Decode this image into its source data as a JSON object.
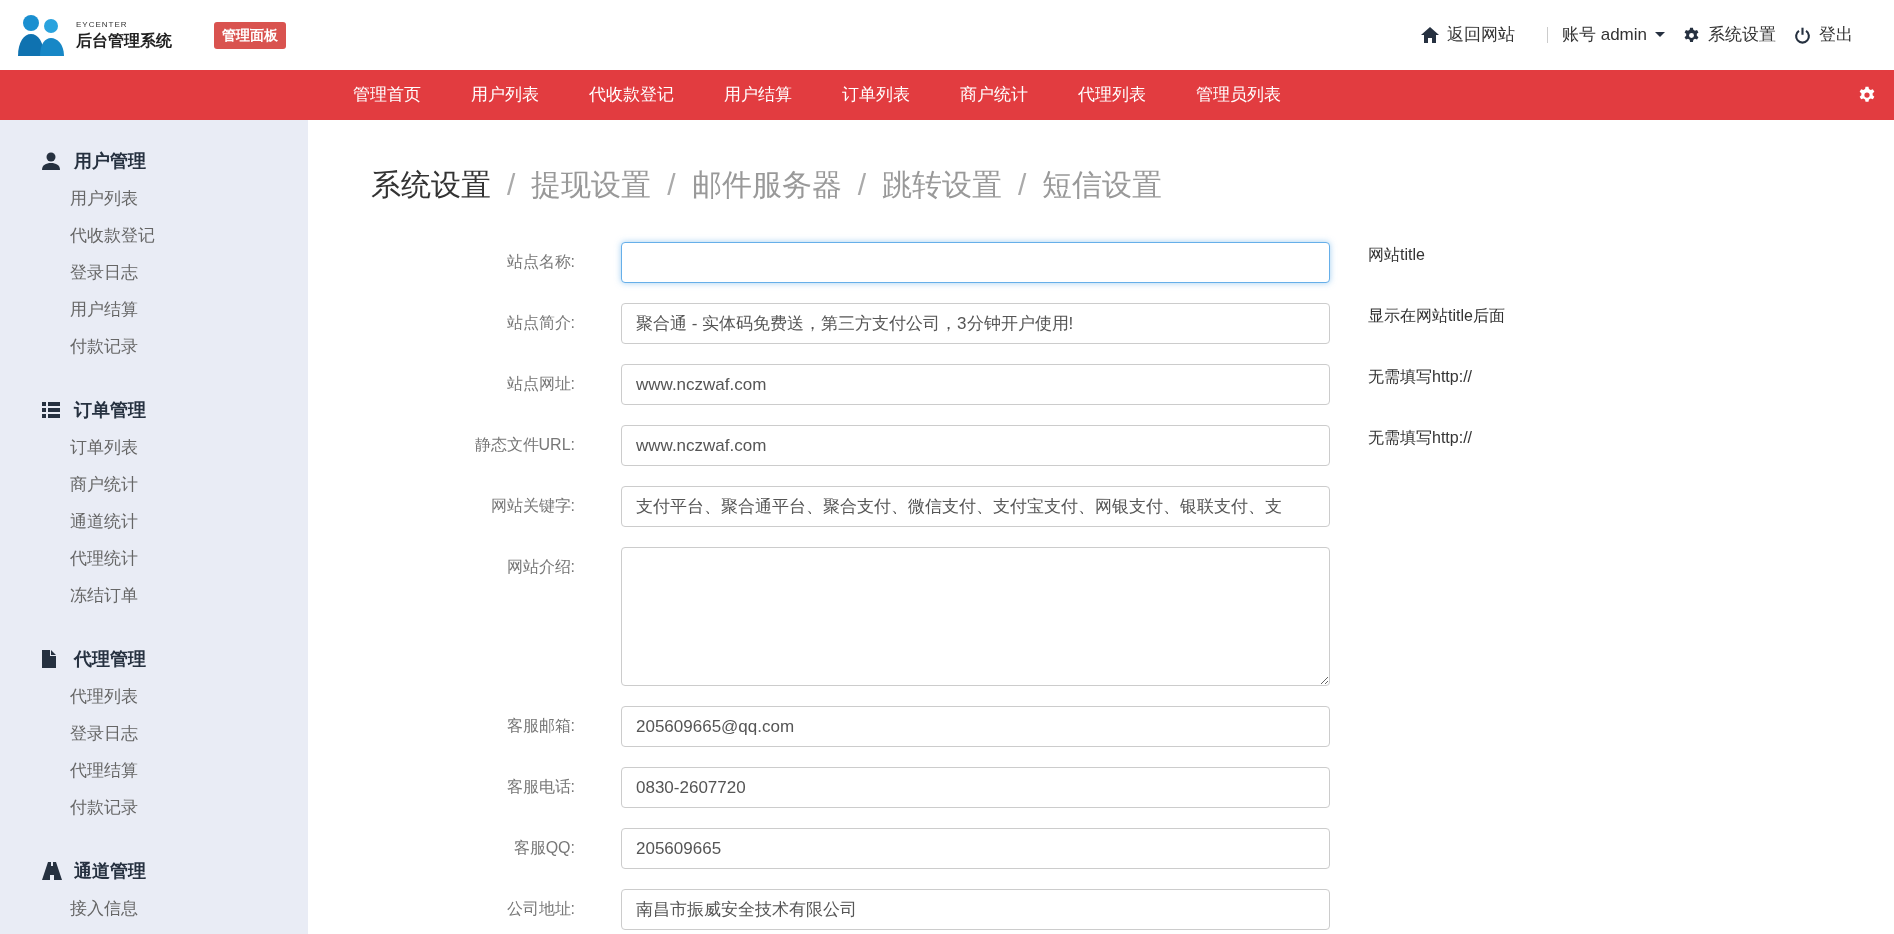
{
  "header": {
    "logo_caption": "EYCENTER",
    "logo_title": "后台管理系统",
    "badge": "管理面板",
    "links": [
      {
        "kind": "home",
        "label": "返回网站"
      },
      {
        "kind": "account",
        "label": "账号 admin"
      },
      {
        "kind": "settings",
        "label": "系统设置"
      },
      {
        "kind": "logout",
        "label": "登出"
      }
    ]
  },
  "nav": {
    "items": [
      "管理首页",
      "用户列表",
      "代收款登记",
      "用户结算",
      "订单列表",
      "商户统计",
      "代理列表",
      "管理员列表"
    ]
  },
  "sidebar": {
    "groups": [
      {
        "kind": "user",
        "title": "用户管理",
        "items": [
          "用户列表",
          "代收款登记",
          "登录日志",
          "用户结算",
          "付款记录"
        ]
      },
      {
        "kind": "list",
        "title": "订单管理",
        "items": [
          "订单列表",
          "商户统计",
          "通道统计",
          "代理统计",
          "冻结订单"
        ]
      },
      {
        "kind": "file",
        "title": "代理管理",
        "items": [
          "代理列表",
          "登录日志",
          "代理结算",
          "付款记录"
        ]
      },
      {
        "kind": "road",
        "title": "通道管理",
        "items": [
          "接入信息"
        ]
      }
    ]
  },
  "breadcrumb": [
    {
      "kind": "link",
      "label": "系统设置",
      "selected": true
    },
    {
      "kind": "separator",
      "label": "/"
    },
    {
      "kind": "link",
      "label": "提现设置",
      "selected": false
    },
    {
      "kind": "separator",
      "label": "/"
    },
    {
      "kind": "link",
      "label": "邮件服务器",
      "selected": false
    },
    {
      "kind": "separator",
      "label": "/"
    },
    {
      "kind": "link",
      "label": "跳转设置",
      "selected": false
    },
    {
      "kind": "separator",
      "label": "/"
    },
    {
      "kind": "link",
      "label": "短信设置",
      "selected": false
    }
  ],
  "form": {
    "fields": [
      {
        "kind": "input",
        "label": "站点名称:",
        "focused": true,
        "hint": "网站title"
      },
      {
        "kind": "input",
        "label": "站点简介:",
        "value": "聚合通 - 实体码免费送，第三方支付公司，3分钟开户使用!",
        "focused": false,
        "hint": "显示在网站title后面"
      },
      {
        "kind": "input",
        "label": "站点网址:",
        "value": "www.nczwaf.com",
        "focused": false,
        "hint": "无需填写http://"
      },
      {
        "kind": "input",
        "label": "静态文件URL:",
        "value": "www.nczwaf.com",
        "focused": false,
        "hint": "无需填写http://"
      },
      {
        "kind": "input",
        "label": "网站关键字:",
        "value": "支付平台、聚合通平台、聚合支付、微信支付、支付宝支付、网银支付、银联支付、支",
        "focused": false
      },
      {
        "kind": "textarea",
        "label": "网站介绍:",
        "focused": false
      },
      {
        "kind": "input",
        "label": "客服邮箱:",
        "value": "205609665@qq.com",
        "focused": false
      },
      {
        "kind": "input",
        "label": "客服电话:",
        "value": "0830-2607720",
        "focused": false
      },
      {
        "kind": "input",
        "label": "客服QQ:",
        "value": "205609665",
        "focused": false
      },
      {
        "kind": "input",
        "label": "公司地址:",
        "value": "南昌市振威安全技术有限公司",
        "focused": false
      }
    ]
  }
}
